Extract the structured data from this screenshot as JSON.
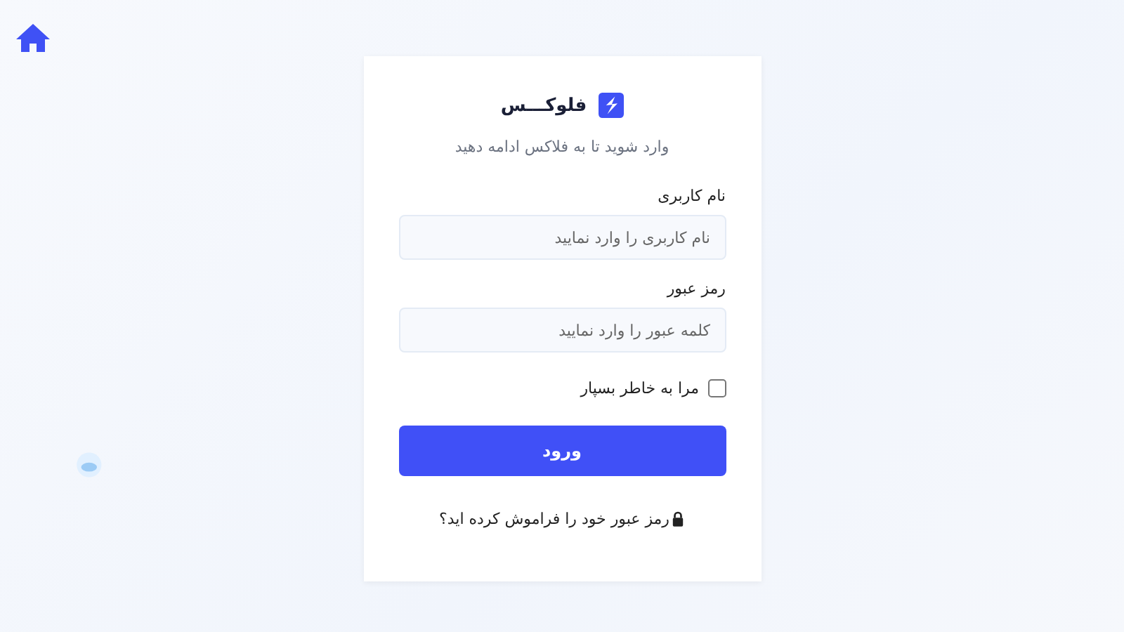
{
  "brand": {
    "name": "فلوکـــس"
  },
  "subtitle": "وارد شوید تا به فلاکس ادامه دهید",
  "fields": [
    {
      "label": "نام کاربری",
      "placeholder": "نام کاربری را وارد نمایید"
    },
    {
      "label": "رمز عبور",
      "placeholder": "کلمه عبور را وارد نمایید"
    }
  ],
  "remember": {
    "label": "مرا به خاطر بسپار",
    "checked": false
  },
  "submit": "ورود",
  "forgot": "رمز عبور خود را فراموش کرده اید؟"
}
